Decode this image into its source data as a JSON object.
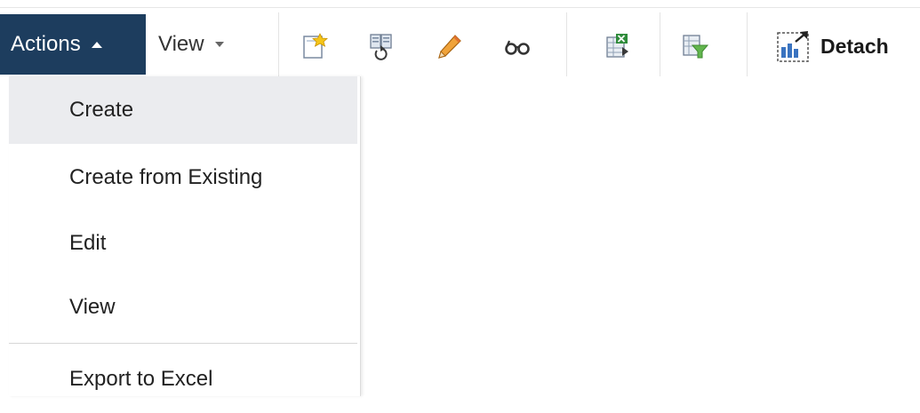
{
  "toolbar": {
    "actions_label": "Actions",
    "view_label": "View",
    "icons": [
      "create-icon",
      "duplicate-icon",
      "edit-pencil-icon",
      "view-glasses-icon",
      "export-excel-icon",
      "filter-icon",
      "detach-icon"
    ],
    "detach_label": "Detach"
  },
  "actions_menu": {
    "items": [
      {
        "label": "Create",
        "highlighted": true
      },
      {
        "label": "Create from Existing"
      },
      {
        "label": "Edit"
      },
      {
        "label": "View"
      },
      {
        "label": "Export to Excel"
      }
    ]
  },
  "colors": {
    "actions_bg": "#1d3d5e",
    "menu_highlight": "#ebecef"
  }
}
